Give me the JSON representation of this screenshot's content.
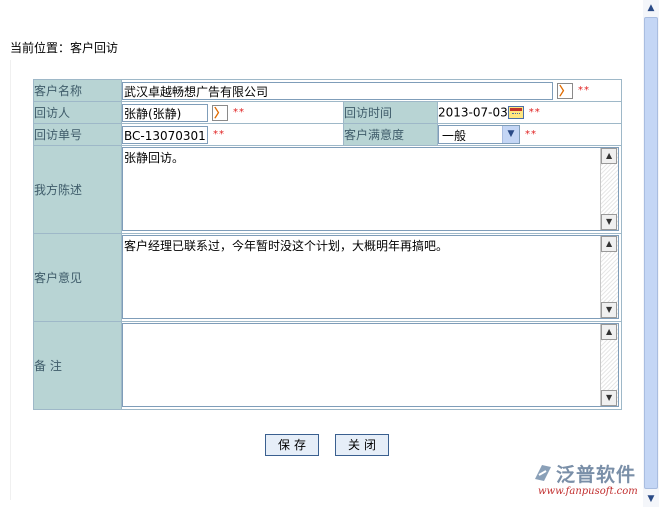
{
  "breadcrumb": "当前位置：客户回访",
  "form": {
    "customer_name_label": "客户名称",
    "customer_name_value": "武汉卓越畅想广告有限公司",
    "visitor_label": "回访人",
    "visitor_value": "张静(张静)",
    "visit_time_label": "回访时间",
    "visit_time_value": "2013-07-03",
    "visit_no_label": "回访单号",
    "visit_no_value": "BC-13070301",
    "satisfaction_label": "客户满意度",
    "satisfaction_value": "一般",
    "our_statement_label": "我方陈述",
    "our_statement_value": "张静回访。",
    "customer_opinion_label": "客户意见",
    "customer_opinion_value": "客户经理已联系过，今年暂时没这个计划，大概明年再搞吧。",
    "remarks_label": "备 注",
    "remarks_value": "",
    "required_mark": "**",
    "arrow_glyph": "〉"
  },
  "buttons": {
    "save": "保存",
    "close": "关闭"
  },
  "logo": {
    "name": "泛普软件",
    "url": "www.fanpusoft.com"
  },
  "colors": {
    "label_bg": "#b8d4d4",
    "border": "#9eb8c8",
    "required": "#e02020"
  }
}
